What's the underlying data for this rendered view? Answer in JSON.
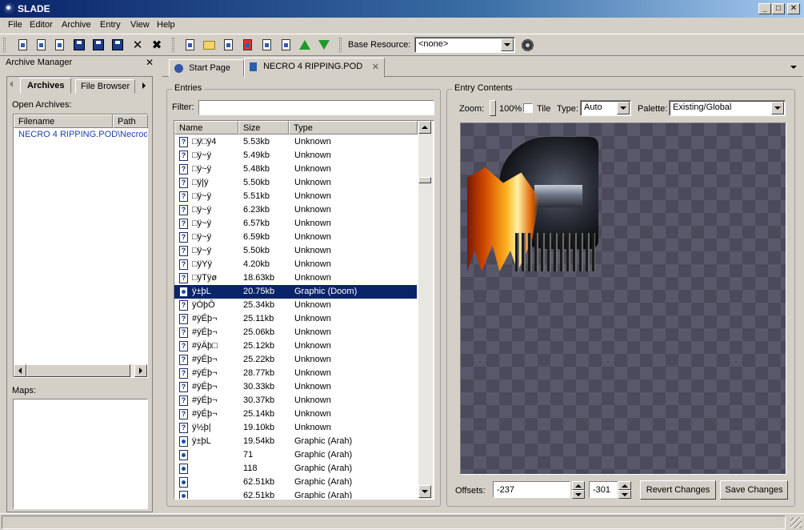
{
  "window": {
    "title": "SLADE",
    "buttons": {
      "minimize": "_",
      "maximize": "□",
      "close": "✕"
    }
  },
  "menu": [
    "File",
    "Editor",
    "Archive",
    "Entry",
    "View",
    "Help"
  ],
  "toolbar": {
    "base_resource_label": "Base Resource:",
    "base_resource_value": "<none>"
  },
  "archive_manager": {
    "title": "Archive Manager",
    "close": "✕",
    "tabs": [
      "Archives",
      "File Browser"
    ],
    "open_archives_label": "Open Archives:",
    "columns": [
      "Filename",
      "Path"
    ],
    "rows": [
      {
        "filename": "NECRO 4 RIPPING.POD",
        "path": "\\Necrod"
      }
    ],
    "maps_label": "Maps:"
  },
  "doc_tabs": [
    {
      "label": "Start Page"
    },
    {
      "label": "NECRO 4 RIPPING.POD",
      "close": "✕"
    }
  ],
  "entries": {
    "title": "Entries",
    "filter_label": "Filter:",
    "filter_value": "",
    "columns": [
      "Name",
      "Size",
      "Type"
    ],
    "rows": [
      {
        "name": "□ÿ□ÿ4",
        "size": "5.53kb",
        "type": "Unknown",
        "icon": "?"
      },
      {
        "name": "□ÿ~ÿ",
        "size": "5.49kb",
        "type": "Unknown",
        "icon": "?"
      },
      {
        "name": "□ÿ~ÿ",
        "size": "5.48kb",
        "type": "Unknown",
        "icon": "?"
      },
      {
        "name": "□ÿ|ÿ",
        "size": "5.50kb",
        "type": "Unknown",
        "icon": "?"
      },
      {
        "name": "□ÿ~ÿ",
        "size": "5.51kb",
        "type": "Unknown",
        "icon": "?"
      },
      {
        "name": "□ÿ~ÿ",
        "size": "6.23kb",
        "type": "Unknown",
        "icon": "?"
      },
      {
        "name": "□ÿ~ÿ",
        "size": "6.57kb",
        "type": "Unknown",
        "icon": "?"
      },
      {
        "name": "□ÿ~ÿ",
        "size": "6.59kb",
        "type": "Unknown",
        "icon": "?"
      },
      {
        "name": "□ÿ~ÿ",
        "size": "5.50kb",
        "type": "Unknown",
        "icon": "?"
      },
      {
        "name": "□ÿYÿ",
        "size": "4.20kb",
        "type": "Unknown",
        "icon": "?"
      },
      {
        "name": "□ÿTÿø",
        "size": "18.63kb",
        "type": "Unknown",
        "icon": "?"
      },
      {
        "name": "ÿ±þL",
        "size": "20.75kb",
        "type": "Graphic (Doom)",
        "icon": "gfx",
        "selected": true
      },
      {
        "name": "ÿÓþÔ",
        "size": "25.34kb",
        "type": "Unknown",
        "icon": "?"
      },
      {
        "name": "#ÿÉþ¬",
        "size": "25.11kb",
        "type": "Unknown",
        "icon": "?"
      },
      {
        "name": "#ÿÉþ¬",
        "size": "25.06kb",
        "type": "Unknown",
        "icon": "?"
      },
      {
        "name": "#ÿÄþ□",
        "size": "25.12kb",
        "type": "Unknown",
        "icon": "?"
      },
      {
        "name": "#ÿÉþ¬",
        "size": "25.22kb",
        "type": "Unknown",
        "icon": "?"
      },
      {
        "name": "#ÿÉþ¬",
        "size": "28.77kb",
        "type": "Unknown",
        "icon": "?"
      },
      {
        "name": "#ÿÉþ¬",
        "size": "30.33kb",
        "type": "Unknown",
        "icon": "?"
      },
      {
        "name": "#ÿÉþ¬",
        "size": "30.37kb",
        "type": "Unknown",
        "icon": "?"
      },
      {
        "name": "#ÿÉþ¬",
        "size": "25.14kb",
        "type": "Unknown",
        "icon": "?"
      },
      {
        "name": "ÿ½þ|",
        "size": "19.10kb",
        "type": "Unknown",
        "icon": "?"
      },
      {
        "name": "ÿ±þL",
        "size": "19.54kb",
        "type": "Graphic (Arah)",
        "icon": "gfx"
      },
      {
        "name": "",
        "size": "71",
        "type": "Graphic (Arah)",
        "icon": "gfx"
      },
      {
        "name": "",
        "size": "118",
        "type": "Graphic (Arah)",
        "icon": "gfx"
      },
      {
        "name": "",
        "size": "62.51kb",
        "type": "Graphic (Arah)",
        "icon": "gfx"
      },
      {
        "name": "",
        "size": "62.51kb",
        "type": "Graphic (Arah)",
        "icon": "gfx"
      }
    ]
  },
  "entry_contents": {
    "title": "Entry Contents",
    "zoom_label": "Zoom:",
    "zoom_value": "100%",
    "tile_label": "Tile",
    "tile_checked": false,
    "type_label": "Type:",
    "type_value": "Auto",
    "palette_label": "Palette:",
    "palette_value": "Existing/Global",
    "offsets_label": "Offsets:",
    "offset_x": "-237",
    "offset_y": "-301",
    "revert_label": "Revert Changes",
    "save_label": "Save Changes"
  }
}
